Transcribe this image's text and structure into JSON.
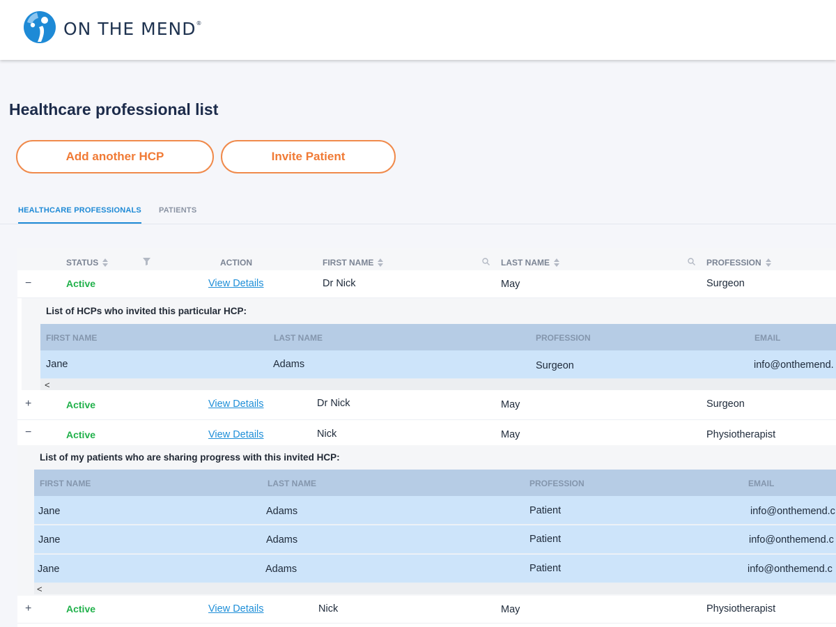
{
  "brand": {
    "name": "ON THE MEND",
    "reg_mark": "®",
    "colors": {
      "primary": "#1e8ad6",
      "accent": "#f07a35",
      "active": "#21b14b"
    }
  },
  "page": {
    "title": "Healthcare professional list"
  },
  "actions": {
    "add_hcp": "Add another HCP",
    "invite_patient": "Invite Patient"
  },
  "tabs": [
    {
      "label": "HEALTHCARE PROFESSIONALS",
      "active": true
    },
    {
      "label": "PATIENTS",
      "active": false
    }
  ],
  "table": {
    "columns": {
      "status": "STATUS",
      "action": "ACTION",
      "first_name": "FIRST NAME",
      "last_name": "LAST NAME",
      "profession": "PROFESSION"
    },
    "icons": {
      "filter": "filter-icon",
      "search": "search-icon",
      "sort": "sort-icon"
    },
    "rows": [
      {
        "expander": "−",
        "status": "Active",
        "action": "View Details",
        "first_name": "Dr  Nick",
        "last_name": "May",
        "profession": "Surgeon"
      },
      {
        "expander": "+",
        "status": "Active",
        "action": "View Details",
        "first_name": "Dr  Nick",
        "last_name": "May",
        "profession": "Surgeon"
      },
      {
        "expander": "−",
        "status": "Active",
        "action": "View Details",
        "first_name": "Nick",
        "last_name": "May",
        "profession": "Physiotherapist"
      },
      {
        "expander": "+",
        "status": "Active",
        "action": "View Details",
        "first_name": "Nick",
        "last_name": "May",
        "profession": "Physiotherapist"
      }
    ]
  },
  "subtable1": {
    "caption": "List of HCPs who invited this particular HCP:",
    "columns": {
      "first_name": "FIRST NAME",
      "last_name": "LAST NAME",
      "profession": "PROFESSION",
      "email": "EMAIL"
    },
    "rows": [
      {
        "first_name": "Jane",
        "last_name": "Adams",
        "profession": "Surgeon",
        "email": "info@onthemend."
      }
    ],
    "scroll_left": "<"
  },
  "subtable2": {
    "caption": "List of my patients who are sharing progress with this invited HCP:",
    "columns": {
      "first_name": "FIRST NAME",
      "last_name": "LAST NAME",
      "profession": "PROFESSION",
      "email": "EMAIL"
    },
    "rows": [
      {
        "first_name": "Jane",
        "last_name": "Adams",
        "profession": "Patient",
        "email": "info@onthemend.c"
      },
      {
        "first_name": "Jane",
        "last_name": "Adams",
        "profession": "Patient",
        "email": "info@onthemend.c"
      },
      {
        "first_name": "Jane",
        "last_name": "Adams",
        "profession": "Patient",
        "email": "info@onthemend.c"
      }
    ],
    "scroll_left": "<"
  }
}
